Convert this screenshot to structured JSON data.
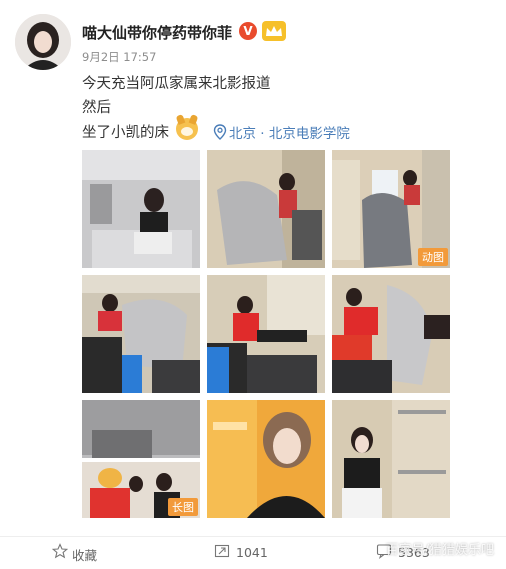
{
  "post": {
    "username": "喵大仙带你停药带你菲",
    "verified_badge": "V",
    "time": "9月2日 17:57",
    "lines": [
      "今天充当阿瓜家属来北影报道",
      "然后",
      "坐了小凯的床"
    ],
    "location": "北京 · 北京电影学院"
  },
  "photos": {
    "gif_tag": "动图",
    "long_tag": "长图"
  },
  "actions": {
    "favorite": "收藏",
    "repost_count": "1041",
    "comment_count": "5363"
  },
  "watermark": "百家号/猎猎娱乐吧",
  "colors": {
    "location": "#4a7db8",
    "badge_v": "#e94b2d",
    "tag": "#f29a3a"
  }
}
